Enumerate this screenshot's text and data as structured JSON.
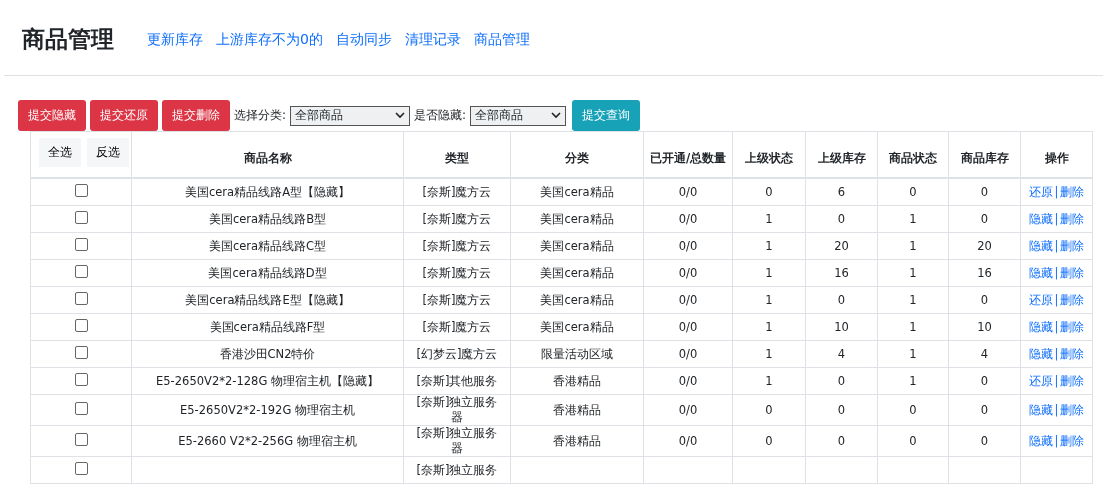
{
  "header": {
    "title": "商品管理",
    "links": [
      "更新库存",
      "上游库存不为0的",
      "自动同步",
      "清理记录",
      "商品管理"
    ]
  },
  "toolbar": {
    "buttons": [
      {
        "label": "提交隐藏",
        "kind": "danger"
      },
      {
        "label": "提交还原",
        "kind": "danger"
      },
      {
        "label": "提交删除",
        "kind": "danger"
      }
    ],
    "filters": [
      {
        "label": "选择分类:",
        "value": "全部商品"
      },
      {
        "label": "是否隐藏:",
        "value": "全部商品"
      }
    ],
    "submit": {
      "label": "提交查询",
      "kind": "info"
    }
  },
  "table": {
    "select_buttons": [
      "全选",
      "反选"
    ],
    "action_separator": "|",
    "columns": [
      "商品名称",
      "类型",
      "分类",
      "已开通/总数量",
      "上级状态",
      "上级库存",
      "商品状态",
      "商品库存",
      "操作"
    ],
    "rows": [
      {
        "checked": false,
        "cells": [
          "美国cera精品线路A型【隐藏】",
          "[奈斯]魔方云",
          "美国cera精品",
          "0/0",
          "0",
          "6",
          "0",
          "0"
        ],
        "actions": [
          "还原",
          "删除"
        ]
      },
      {
        "checked": false,
        "cells": [
          "美国cera精品线路B型",
          "[奈斯]魔方云",
          "美国cera精品",
          "0/0",
          "1",
          "0",
          "1",
          "0"
        ],
        "actions": [
          "隐藏",
          "删除"
        ]
      },
      {
        "checked": false,
        "cells": [
          "美国cera精品线路C型",
          "[奈斯]魔方云",
          "美国cera精品",
          "0/0",
          "1",
          "20",
          "1",
          "20"
        ],
        "actions": [
          "隐藏",
          "删除"
        ]
      },
      {
        "checked": false,
        "cells": [
          "美国cera精品线路D型",
          "[奈斯]魔方云",
          "美国cera精品",
          "0/0",
          "1",
          "16",
          "1",
          "16"
        ],
        "actions": [
          "隐藏",
          "删除"
        ]
      },
      {
        "checked": false,
        "cells": [
          "美国cera精品线路E型【隐藏】",
          "[奈斯]魔方云",
          "美国cera精品",
          "0/0",
          "1",
          "0",
          "1",
          "0"
        ],
        "actions": [
          "还原",
          "删除"
        ]
      },
      {
        "checked": false,
        "cells": [
          "美国cera精品线路F型",
          "[奈斯]魔方云",
          "美国cera精品",
          "0/0",
          "1",
          "10",
          "1",
          "10"
        ],
        "actions": [
          "隐藏",
          "删除"
        ]
      },
      {
        "checked": false,
        "cells": [
          "香港沙田CN2特价",
          "[幻梦云]魔方云",
          "限量活动区域",
          "0/0",
          "1",
          "4",
          "1",
          "4"
        ],
        "actions": [
          "隐藏",
          "删除"
        ]
      },
      {
        "checked": false,
        "cells": [
          "E5-2650V2*2-128G 物理宿主机【隐藏】",
          "[奈斯]其他服务",
          "香港精品",
          "0/0",
          "1",
          "0",
          "1",
          "0"
        ],
        "actions": [
          "还原",
          "删除"
        ]
      },
      {
        "checked": false,
        "cells": [
          "E5-2650V2*2-192G 物理宿主机",
          "[奈斯]独立服务器",
          "香港精品",
          "0/0",
          "0",
          "0",
          "0",
          "0"
        ],
        "actions": [
          "隐藏",
          "删除"
        ]
      },
      {
        "checked": false,
        "cells": [
          "E5-2660 V2*2-256G 物理宿主机",
          "[奈斯]独立服务器",
          "香港精品",
          "0/0",
          "0",
          "0",
          "0",
          "0"
        ],
        "actions": [
          "隐藏",
          "删除"
        ]
      },
      {
        "checked": false,
        "cells": [
          "",
          "[奈斯]独立服务",
          "",
          "",
          "",
          "",
          "",
          ""
        ],
        "actions": []
      }
    ]
  }
}
